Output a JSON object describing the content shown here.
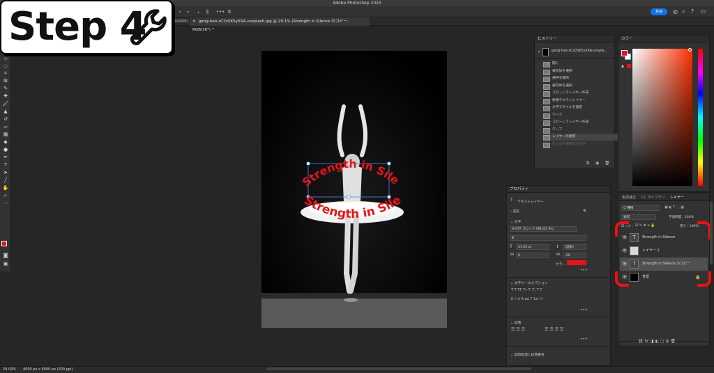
{
  "app": {
    "title": "Adobe Photoshop 2025",
    "share_label": "共有"
  },
  "badge": {
    "text": "Step 4",
    "icon": "wrench-icon"
  },
  "tabs": [
    {
      "label": "(RGB/8)"
    },
    {
      "label": "gang-hao-zCZzSK5yXSA-unsplash.jpg @ 29.1% (Strength in Silence のコピー, RGB/16*) *"
    }
  ],
  "canvas": {
    "warped_text_top": "Strength in Silence",
    "warped_text_bottom": "Strength in Silence",
    "text_color": "#e8141a"
  },
  "history": {
    "title": "ヒストリー",
    "snapshot": "gang-hao-zCZzSK5yXSA-unspla...",
    "items": [
      {
        "label": "開く"
      },
      {
        "label": "被写体を選択"
      },
      {
        "label": "選択を解除"
      },
      {
        "label": "被写体を選択"
      },
      {
        "label": "コピーしてレイヤー作成"
      },
      {
        "label": "新規テキストレイヤー"
      },
      {
        "label": "文字スタイルを設定"
      },
      {
        "label": "ワープ"
      },
      {
        "label": "コピーしてレイヤー作成"
      },
      {
        "label": "ワープ"
      },
      {
        "label": "レイヤーの順序"
      },
      {
        "label": "塗りの不透明度を変更"
      }
    ]
  },
  "color_panel": {
    "title": "カラー",
    "foreground": "#e8141a",
    "background": "#ffffff"
  },
  "layers_panel": {
    "tabs": [
      "色調補正",
      "CC ライブラリ",
      "レイヤー"
    ],
    "kind_label": "Q 種類",
    "blend_mode": "通常",
    "opacity_label": "不透明度 : 100%",
    "lock_label": "ロック :",
    "fill_label": "塗り : 100%",
    "layers": [
      {
        "name": "Strength in Silence",
        "thumb": "T"
      },
      {
        "name": "レイヤー 1",
        "thumb": ""
      },
      {
        "name": "Strength in Silence のコピー",
        "thumb": "T"
      },
      {
        "name": "背景",
        "thumb": ""
      }
    ]
  },
  "properties": {
    "title": "プロパティ",
    "kind": "テキストレイヤー",
    "transform_label": "変形",
    "type_section": "文字",
    "font": "A-OTF ゴシック MB101 Pro",
    "style": "B",
    "size": "41.04 pt",
    "leading": "(自動)",
    "kerning": "0",
    "tracking": "-20",
    "color_label": "カラー",
    "type_options": "文字ツールオプション",
    "paragraph": "段落",
    "justification": "禁則処理と段落番号"
  },
  "status": {
    "zoom": "29.09%",
    "doc_info": "4000 px x 6000 px (300 ppi)"
  }
}
